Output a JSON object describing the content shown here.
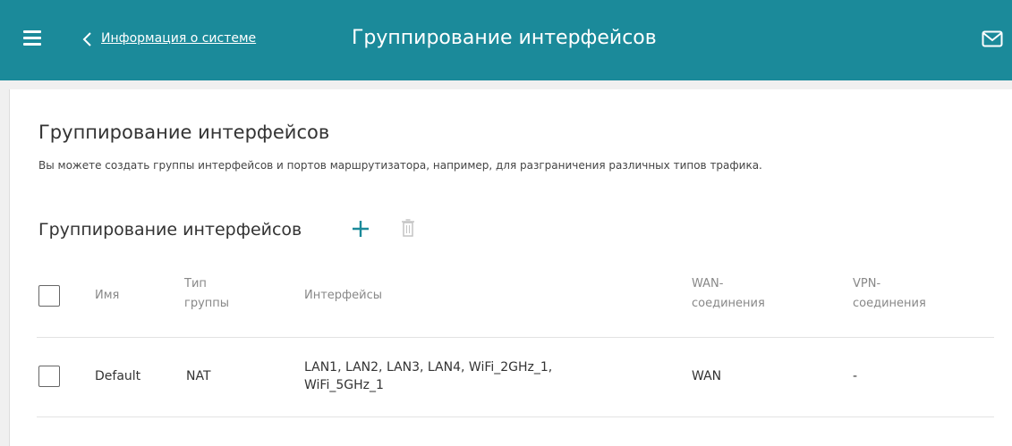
{
  "header": {
    "back_link": "Информация о системе",
    "title": "Группирование интерфейсов"
  },
  "main": {
    "title": "Группирование интерфейсов",
    "description": "Вы можете создать группы интерфейсов и портов маршрутизатора, например, для разграничения различных типов трафика.",
    "table_title": "Группирование интерфейсов"
  },
  "table": {
    "columns": {
      "name": "Имя",
      "type_l1": "Тип",
      "type_l2": "группы",
      "interfaces": "Интерфейсы",
      "wan_l1": "WAN-",
      "wan_l2": "соединения",
      "vpn_l1": "VPN-",
      "vpn_l2": "соединения"
    },
    "rows": [
      {
        "name": "Default",
        "type": "NAT",
        "interfaces_l1": "LAN1, LAN2, LAN3, LAN4, WiFi_2GHz_1,",
        "interfaces_l2": "WiFi_5GHz_1",
        "wan": "WAN",
        "vpn": "-"
      }
    ]
  },
  "icons": {
    "menu": "menu-icon",
    "back": "chevron-left-icon",
    "mail": "mail-icon",
    "add": "plus-icon",
    "delete": "trash-icon"
  },
  "colors": {
    "header_bg": "#1b8a9a",
    "accent": "#1b8a9a",
    "page_bg": "#f0f0f0"
  }
}
